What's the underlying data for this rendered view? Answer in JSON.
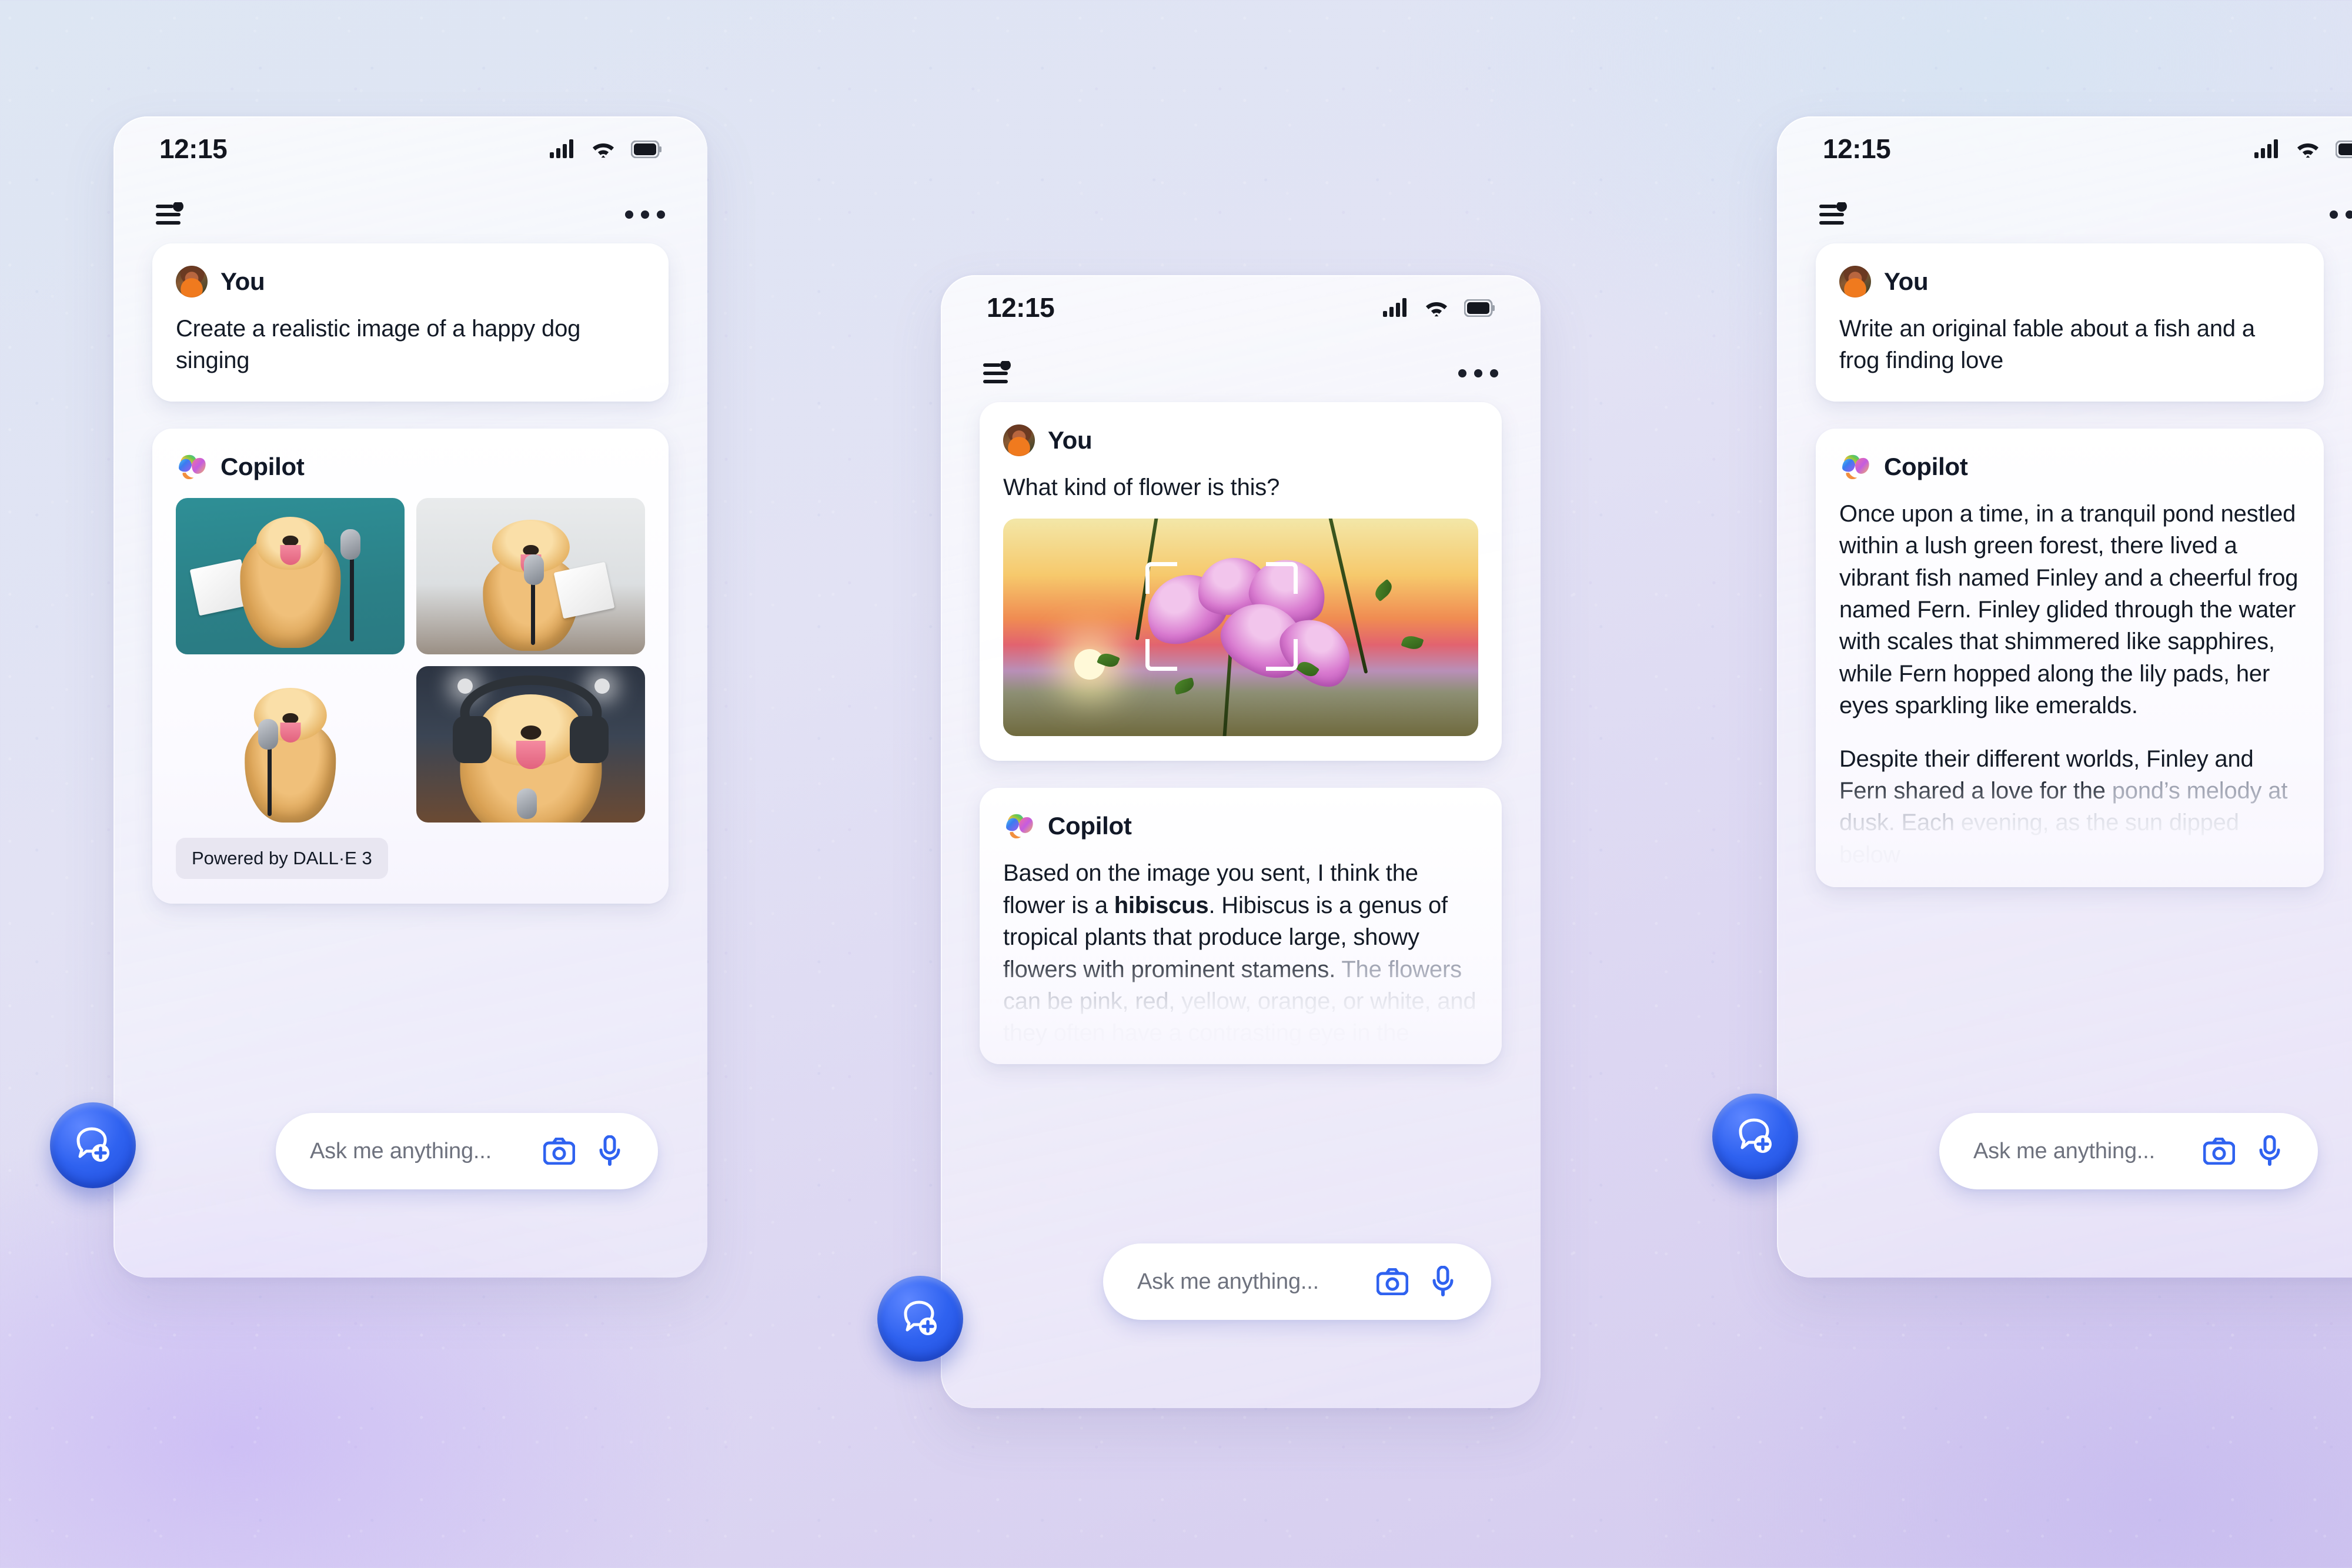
{
  "app": {
    "name": "Copilot",
    "user_label": "You",
    "assistant_label": "Copilot"
  },
  "status_bar": {
    "time": "12:15",
    "signal_icon": "cellular-signal-icon",
    "wifi_icon": "wifi-icon",
    "battery_icon": "battery-icon"
  },
  "app_bar": {
    "menu_icon": "filter-lines-icon",
    "overflow_icon": "more-options-icon"
  },
  "composer": {
    "placeholder": "Ask me anything...",
    "camera_icon": "camera-icon",
    "mic_icon": "microphone-icon",
    "new_chat_icon": "new-chat-bubble-plus-icon"
  },
  "colors": {
    "accent_blue": "#2f62f0",
    "card_white": "#ffffff",
    "text_primary": "#131a26",
    "text_muted": "#6e727e",
    "chip_bg": "#e8e6f1"
  },
  "phones": [
    {
      "id": "left",
      "messages": [
        {
          "role": "You",
          "text": "Create a realistic image of a happy dog singing"
        },
        {
          "role": "Copilot",
          "type": "images",
          "images": [
            {
              "alt": "Golden retriever standing on hind legs holding sheet music beside a microphone on a teal background"
            },
            {
              "alt": "Golden retriever sitting and singing into a microphone with a lyric sheet, white wall background"
            },
            {
              "alt": "Golden retriever singing into a microphone on a grey studio backdrop"
            },
            {
              "alt": "Golden retriever wearing headphones singing into a vintage microphone in front of a crowd"
            }
          ],
          "footer_chip": "Powered by DALL·E 3"
        }
      ]
    },
    {
      "id": "center",
      "messages": [
        {
          "role": "You",
          "text": "What kind of flower is this?",
          "type": "photo",
          "photo_alt": "Pink hibiscus flowers on a branch at sunset with a scan framing overlay"
        },
        {
          "role": "Copilot",
          "type": "text_fading",
          "segments": [
            {
              "text": "Based on the image you sent, I think the flower is a ",
              "style": "normal"
            },
            {
              "text": "hibiscus",
              "style": "bold"
            },
            {
              "text": ". Hibiscus is a genus of tropical plants that produce large, showy flowers with prominent stamens. ",
              "style": "normal"
            },
            {
              "text": "The flowers can be pink, red, ",
              "style": "fade-a"
            },
            {
              "text": "yellow, orange, or white, and they ",
              "style": "fade-b"
            },
            {
              "text": "often have a contrasting eye in the",
              "style": "fade-c"
            }
          ]
        }
      ]
    },
    {
      "id": "right",
      "messages": [
        {
          "role": "You",
          "text": "Write an original fable about a fish and a frog finding love"
        },
        {
          "role": "Copilot",
          "type": "text_fading",
          "segments": [
            {
              "text": "Once upon a time, in a tranquil pond nestled within a lush green forest, there lived a vibrant fish named Finley and a cheerful frog named Fern. Finley glided through the water with scales that shimmered like sapphires, while Fern hopped along the lily pads, her eyes sparkling like emeralds.",
              "style": "normal"
            },
            {
              "text": "Despite their different worlds, Finley and Fern shared a love for the ",
              "style": "normal"
            },
            {
              "text": "pond’s melody at dusk. Each ",
              "style": "fade-a"
            },
            {
              "text": "evening, as the sun dipped below",
              "style": "fade-b"
            }
          ]
        }
      ]
    }
  ]
}
